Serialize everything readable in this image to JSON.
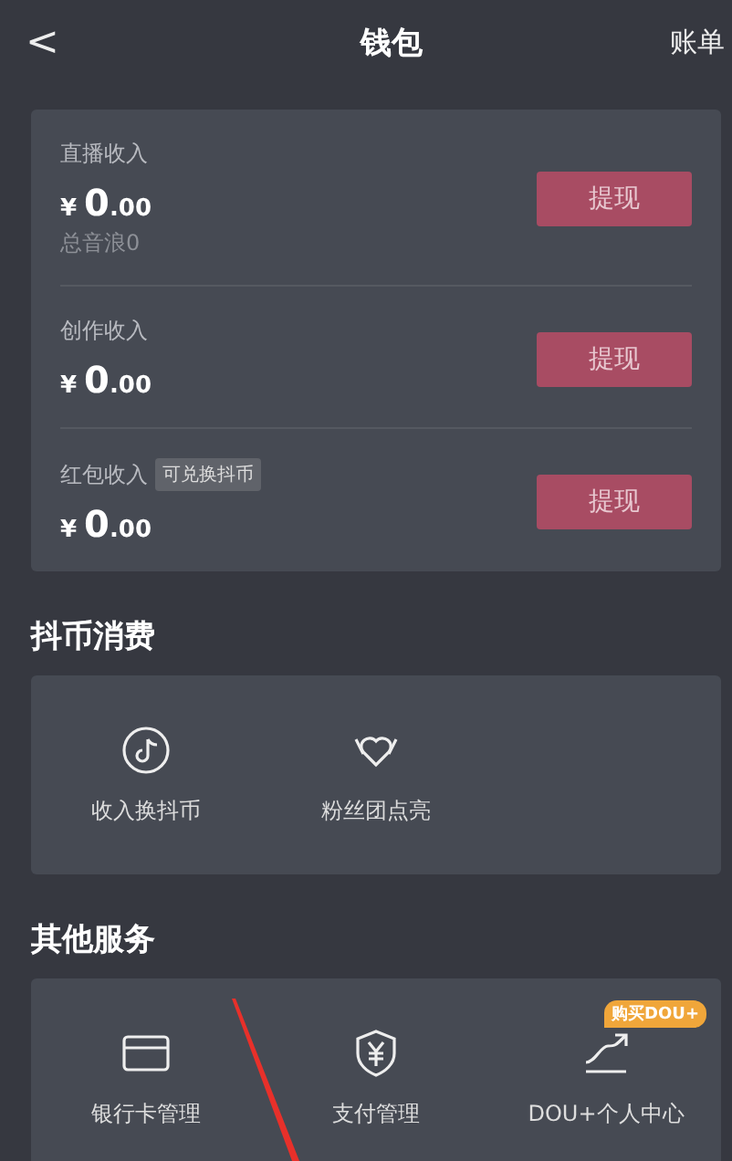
{
  "header": {
    "back": "<",
    "title": "钱包",
    "action": "账单"
  },
  "income": [
    {
      "label": "直播收入",
      "currency": "¥",
      "amount_int": "0",
      "amount_dec": ".00",
      "note": "总音浪0",
      "button": "提现"
    },
    {
      "label": "创作收入",
      "currency": "¥",
      "amount_int": "0",
      "amount_dec": ".00",
      "button": "提现"
    },
    {
      "label": "红包收入",
      "tag": "可兑换抖币",
      "currency": "¥",
      "amount_int": "0",
      "amount_dec": ".00",
      "button": "提现"
    }
  ],
  "sections": [
    {
      "title": "抖币消费",
      "items": [
        {
          "kind": "note",
          "label": "收入换抖币"
        },
        {
          "kind": "heart",
          "label": "粉丝团点亮"
        }
      ]
    },
    {
      "title": "其他服务",
      "items": [
        {
          "kind": "card",
          "label": "银行卡管理"
        },
        {
          "kind": "shield",
          "label": "支付管理"
        },
        {
          "kind": "trend",
          "label": "DOU+个人中心",
          "badge": "购买DOU+"
        }
      ]
    }
  ]
}
